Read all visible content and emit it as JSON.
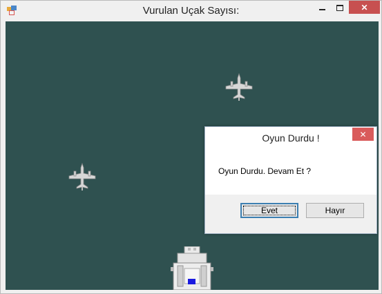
{
  "window": {
    "title": "Vurulan Uçak Sayısı:",
    "app_icon": "windows-form-icon",
    "controls": {
      "minimize": "minimize-icon",
      "maximize": "maximize-icon",
      "close": "close-icon"
    }
  },
  "game": {
    "background_color": "#2f5150",
    "enemies": [
      "enemy-plane",
      "enemy-plane"
    ],
    "player": "player-ship"
  },
  "dialog": {
    "title": "Oyun Durdu !",
    "message": "Oyun Durdu. Devam Et ?",
    "yes_label": "Evet",
    "no_label": "Hayır",
    "close_icon": "close-icon"
  }
}
